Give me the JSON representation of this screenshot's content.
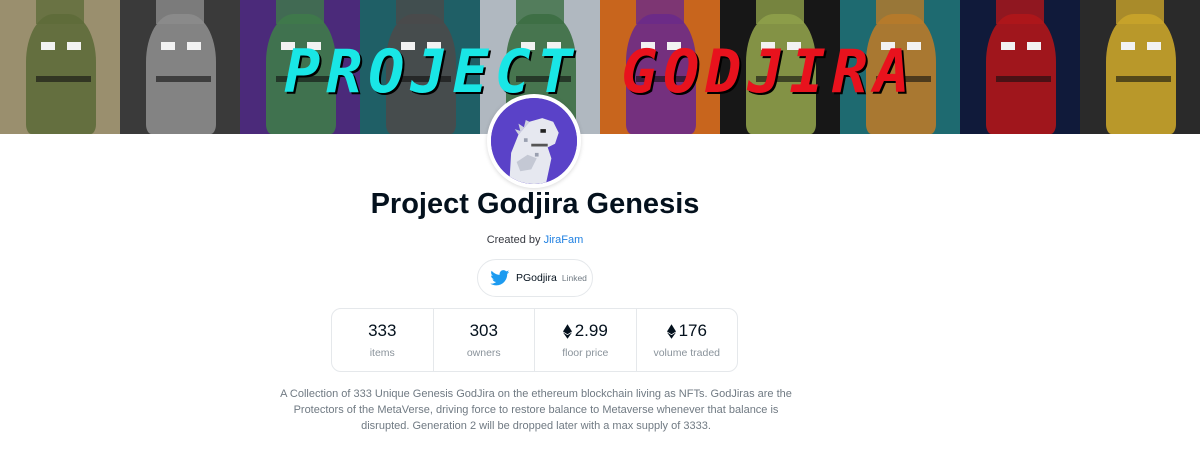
{
  "banner": {
    "title_word1": "PROJECT",
    "title_word2": "GODJIRA",
    "title_color1": "#19e6e6",
    "title_color2": "#e8121d",
    "tiles": [
      {
        "bg": "#9a8f6e",
        "face": "#5e6b3a"
      },
      {
        "bg": "#3a3a3a",
        "face": "#8c8c8c"
      },
      {
        "bg": "#4b2a7a",
        "face": "#3f7a4a"
      },
      {
        "bg": "#1f5f66",
        "face": "#4a4a4a"
      },
      {
        "bg": "#b0b8c0",
        "face": "#3c6e42"
      },
      {
        "bg": "#c8651d",
        "face": "#6a2a8a"
      },
      {
        "bg": "#171717",
        "face": "#8fa04a"
      },
      {
        "bg": "#1e6a70",
        "face": "#b87a2a"
      },
      {
        "bg": "#101a3a",
        "face": "#b0161a"
      },
      {
        "bg": "#2a2a2a",
        "face": "#c9a42a"
      }
    ]
  },
  "avatar": {
    "icon": "godjira-avatar",
    "bg": "#5a42c8"
  },
  "collection": {
    "title": "Project Godjira Genesis",
    "created_by_label": "Created by",
    "creator": "JiraFam"
  },
  "social": {
    "icon": "twitter-icon",
    "handle": "PGodjira",
    "status": "Linked",
    "brand_color": "#1d9bf0"
  },
  "stats": [
    {
      "value": "333",
      "label": "items",
      "eth": false
    },
    {
      "value": "303",
      "label": "owners",
      "eth": false
    },
    {
      "value": "2.99",
      "label": "floor price",
      "eth": true
    },
    {
      "value": "176",
      "label": "volume traded",
      "eth": true
    }
  ],
  "description": "A Collection of 333 Unique Genesis GodJira on the ethereum blockchain living as NFTs. GodJiras are the Protectors of the MetaVerse, driving force to restore balance to Metaverse whenever that balance is disrupted. Generation 2 will be dropped later with a max supply of 3333."
}
